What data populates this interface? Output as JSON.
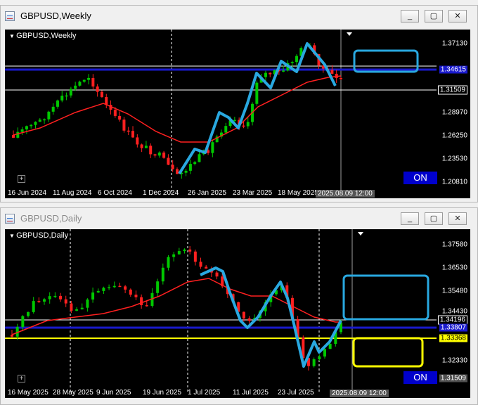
{
  "weekly": {
    "title": "GBPUSD,Weekly",
    "symbol_label": "GBPUSD,Weekly",
    "price_ticks": [
      "1.37130",
      "1.34615",
      "1.31509",
      "1.28970",
      "1.26250",
      "1.23530",
      "1.20810"
    ],
    "hline_blue_label": "1.34615",
    "hline_white_label": "1.31509",
    "date_labels": [
      "16 Jun 2024",
      "11 Aug 2024",
      "6 Oct 2024",
      "1 Dec 2024",
      "26 Jan 2025",
      "23 Mar 2025",
      "18 May 2025"
    ],
    "cursor_time": "2025.08.09 12:00",
    "on_label": "ON"
  },
  "daily": {
    "title": "GBPUSD,Daily",
    "symbol_label": "GBPUSD,Daily",
    "price_ticks": [
      "1.37580",
      "1.36530",
      "1.35480",
      "1.34430",
      "1.34196",
      "1.33807",
      "1.33368",
      "1.32330",
      "1.31509"
    ],
    "date_labels": [
      "16 May 2025",
      "28 May 2025",
      "9 Jun 2025",
      "19 Jun 2025",
      "1 Jul 2025",
      "11 Jul 2025",
      "23 Jul 2025"
    ],
    "cursor_time": "2025.08.09 12:00",
    "on_label": "ON"
  },
  "window_buttons": {
    "minimize": "_",
    "restore": "▢",
    "close": "✕"
  },
  "colors": {
    "bull": "#00c800",
    "bear": "#ff2020",
    "ma": "#ff2020",
    "trend": "#29a8e0",
    "blue_line": "#1a1acc",
    "yellow_line": "#ffff00",
    "on_bg": "#0000cc"
  }
}
